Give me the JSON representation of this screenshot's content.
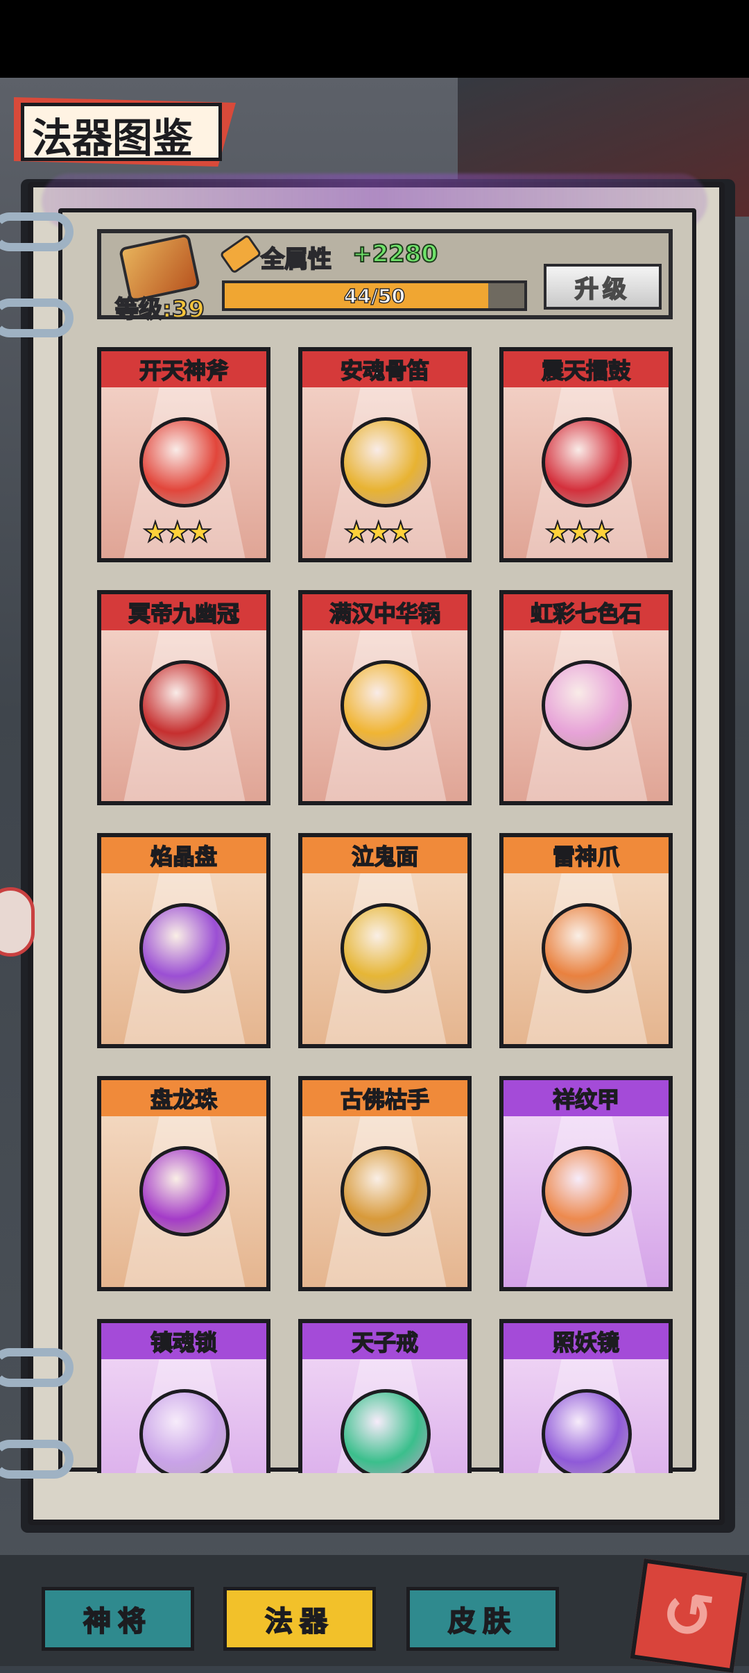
{
  "header": {
    "title": "法器图鉴"
  },
  "level_panel": {
    "level_label": "等级:39",
    "attr_label": "全属性",
    "attr_value": "+2280",
    "progress_text": "44/50",
    "progress_fraction": 0.88,
    "upgrade_label": "升级"
  },
  "cards": [
    {
      "name": "开天神斧",
      "rarity": "red",
      "stars": "★★★",
      "art_color": "#e2463b"
    },
    {
      "name": "安魂骨笛",
      "rarity": "red",
      "stars": "★★★",
      "art_color": "#e8b332"
    },
    {
      "name": "震天擂鼓",
      "rarity": "red",
      "stars": "★★★",
      "art_color": "#d4303c"
    },
    {
      "name": "冥帝九幽冠",
      "rarity": "red",
      "stars": "",
      "art_color": "#c62f2f"
    },
    {
      "name": "满汉中华锅",
      "rarity": "red",
      "stars": "",
      "art_color": "#f0b534"
    },
    {
      "name": "虹彩七色石",
      "rarity": "red",
      "stars": "",
      "art_color": "#e7a3d8"
    },
    {
      "name": "焰晶盘",
      "rarity": "orange",
      "stars": "",
      "art_color": "#9b4fd4"
    },
    {
      "name": "泣鬼面",
      "rarity": "orange",
      "stars": "",
      "art_color": "#e6b636"
    },
    {
      "name": "雷神爪",
      "rarity": "orange",
      "stars": "",
      "art_color": "#e9813f"
    },
    {
      "name": "盘龙珠",
      "rarity": "orange",
      "stars": "",
      "art_color": "#a43bc8"
    },
    {
      "name": "古佛枯手",
      "rarity": "orange",
      "stars": "",
      "art_color": "#d89a3a"
    },
    {
      "name": "祥纹甲",
      "rarity": "purple",
      "stars": "",
      "art_color": "#ed8a4e"
    },
    {
      "name": "镇魂锁",
      "rarity": "purple",
      "stars": "",
      "art_color": "#c9a3e8"
    },
    {
      "name": "天子戒",
      "rarity": "purple",
      "stars": "",
      "art_color": "#3bbf8c"
    },
    {
      "name": "照妖镜",
      "rarity": "purple",
      "stars": "",
      "art_color": "#8f5ad8"
    }
  ],
  "tabs": {
    "hero": "神将",
    "artifact": "法器",
    "skin": "皮肤"
  },
  "icons": {
    "level": "scroll-icon",
    "attr": "wrench-icon",
    "side": "gamepad-icon",
    "back": "return-arrow-icon"
  }
}
